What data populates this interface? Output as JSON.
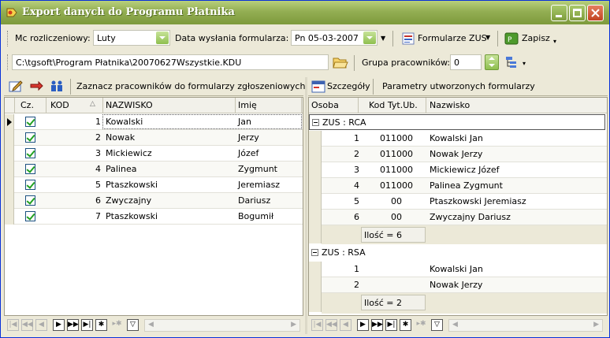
{
  "window": {
    "title": "Export danych do Programu Płatnika"
  },
  "toolbar1": {
    "period_label": "Mc rozliczeniowy:",
    "period_value": "Luty",
    "send_date_label": "Data wysłania formularza:",
    "send_date_value": "Pn 05-03-2007",
    "forms_label": "Formularze ZUS",
    "save_label": "Zapisz"
  },
  "toolbar2": {
    "path_value": "C:\\tgsoft\\Program Płatnika\\20070627Wszystkie.KDU",
    "group_label": "Grupa pracowników:",
    "group_value": "0"
  },
  "left_panel": {
    "mark_label": "Zaznacz pracowników do formularzy zgłoszeniowych",
    "columns": [
      "Cz.",
      "KOD",
      "NAZWISKO",
      "Imię"
    ],
    "rows": [
      {
        "kod": "1",
        "nazwisko": "Kowalski",
        "imie": "Jan",
        "checked": true
      },
      {
        "kod": "2",
        "nazwisko": "Nowak",
        "imie": "Jerzy",
        "checked": true
      },
      {
        "kod": "3",
        "nazwisko": "Mickiewicz",
        "imie": "Józef",
        "checked": true
      },
      {
        "kod": "4",
        "nazwisko": "Palinea",
        "imie": "Zygmunt",
        "checked": true
      },
      {
        "kod": "5",
        "nazwisko": "Ptaszkowski",
        "imie": "Jeremiasz",
        "checked": true
      },
      {
        "kod": "6",
        "nazwisko": "Zwyczajny",
        "imie": "Dariusz",
        "checked": true
      },
      {
        "kod": "7",
        "nazwisko": "Ptaszkowski",
        "imie": "Bogumił",
        "checked": true
      }
    ]
  },
  "right_panel": {
    "details_label": "Szczegóły",
    "params_label": "Parametry utworzonych formularzy",
    "columns": [
      "Osoba",
      "Kod Tyt.Ub.",
      "Nazwisko"
    ],
    "groups": [
      {
        "title": "ZUS : RCA",
        "rows": [
          {
            "osoba": "1",
            "kod": "011000",
            "nazwisko": "Kowalski Jan"
          },
          {
            "osoba": "2",
            "kod": "011000",
            "nazwisko": "Nowak Jerzy"
          },
          {
            "osoba": "3",
            "kod": "011000",
            "nazwisko": "Mickiewicz Józef"
          },
          {
            "osoba": "4",
            "kod": "011000",
            "nazwisko": "Palinea Zygmunt"
          },
          {
            "osoba": "5",
            "kod": "00",
            "nazwisko": "Ptaszkowski Jeremiasz"
          },
          {
            "osoba": "6",
            "kod": "00",
            "nazwisko": "Zwyczajny Dariusz"
          }
        ],
        "summary": "Ilość = 6"
      },
      {
        "title": "ZUS : RSA",
        "rows": [
          {
            "osoba": "1",
            "kod": "",
            "nazwisko": "Kowalski Jan"
          },
          {
            "osoba": "2",
            "kod": "",
            "nazwisko": "Nowak Jerzy"
          }
        ],
        "summary": "Ilość = 2"
      }
    ]
  },
  "icons": [
    "app-icon",
    "calendar-dropdown-icon",
    "forms-icon",
    "save-icon",
    "folder-open-icon",
    "spin-icon",
    "tree-icon",
    "edit-icon",
    "move-icon",
    "people-icon",
    "details-icon",
    "sort-icon"
  ],
  "colors": {
    "titlebar": "#93ae53",
    "window_bg": "#ece9d8",
    "check_green": "#21a121"
  }
}
